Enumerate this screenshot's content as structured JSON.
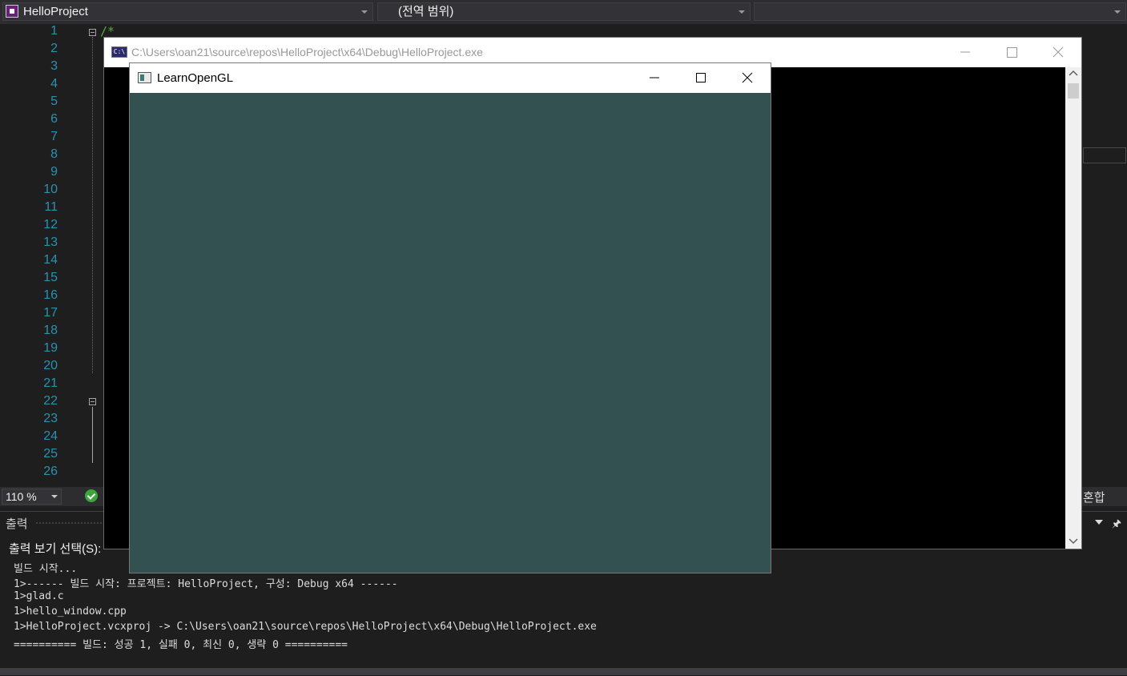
{
  "navbar": {
    "project": "HelloProject",
    "scope": "(전역 범위)",
    "member": ""
  },
  "editor": {
    "line_numbers": [
      "1",
      "2",
      "3",
      "4",
      "5",
      "6",
      "7",
      "8",
      "9",
      "10",
      "11",
      "12",
      "13",
      "14",
      "15",
      "16",
      "17",
      "18",
      "19",
      "20",
      "21",
      "22",
      "23",
      "24",
      "25",
      "26"
    ],
    "comment_open": "/*",
    "zoom": "110 %",
    "line_ending": "혼합"
  },
  "console_window": {
    "title": "C:\\Users\\oan21\\source\\repos\\HelloProject\\x64\\Debug\\HelloProject.exe",
    "icon": "C:\\"
  },
  "gl_window": {
    "title": "LearnOpenGL",
    "clear_color": "#335151"
  },
  "output": {
    "title": "출력",
    "show_from_label": "출력 보기 선택(S):",
    "lines": [
      "빌드 시작...",
      "1>------ 빌드 시작: 프로젝트: HelloProject, 구성: Debug x64 ------",
      "1>glad.c",
      "1>hello_window.cpp",
      "1>HelloProject.vcxproj -> C:\\Users\\oan21\\source\\repos\\HelloProject\\x64\\Debug\\HelloProject.exe",
      "========== 빌드: 성공 1, 실패 0, 최신 0, 생략 0 =========="
    ]
  },
  "colors": {
    "line_number": "#2b91af",
    "comment": "#57a64a",
    "gl_clear": "#335151"
  }
}
